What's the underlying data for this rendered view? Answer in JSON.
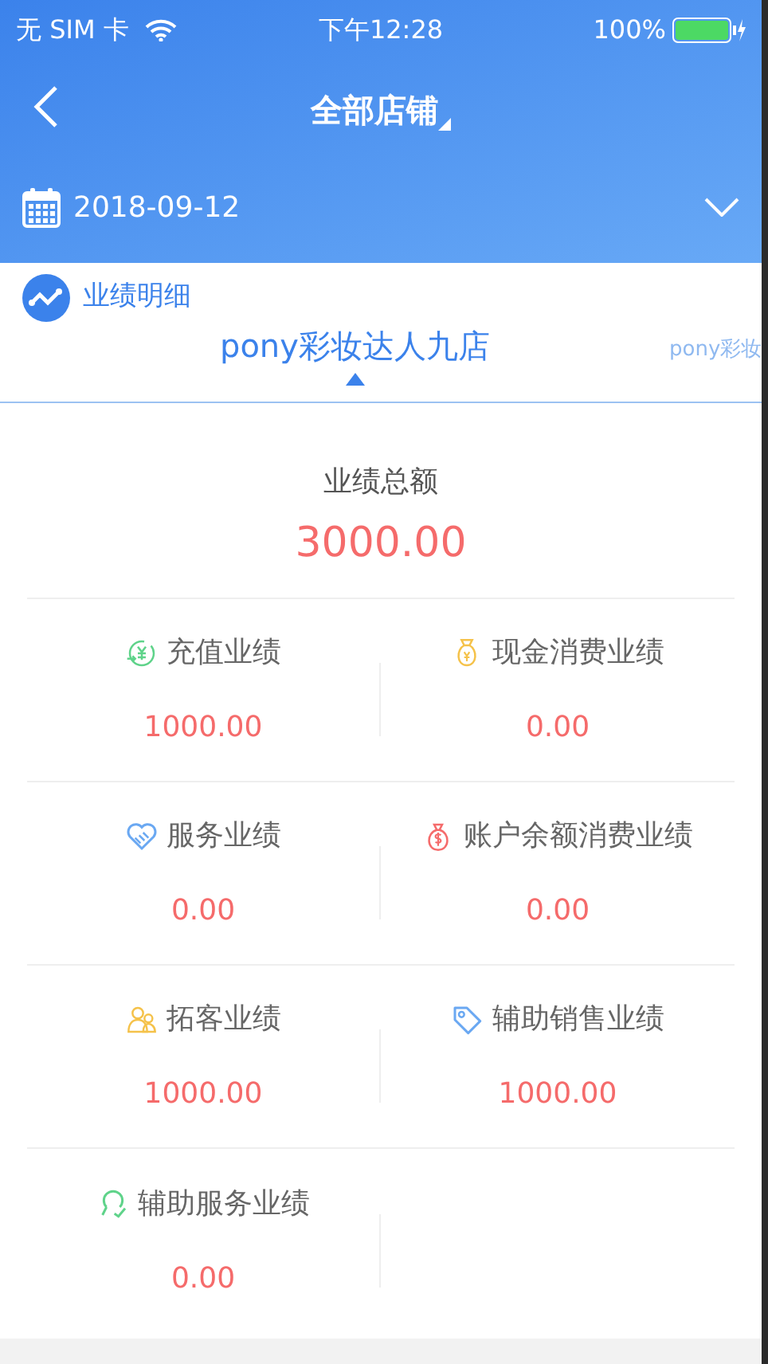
{
  "status_bar": {
    "carrier": "无 SIM 卡",
    "time": "下午12:28",
    "battery": "100%"
  },
  "nav": {
    "title": "全部店铺"
  },
  "date_picker": {
    "value": "2018-09-12"
  },
  "section": {
    "title": "业绩明细"
  },
  "store_tabs": [
    {
      "label": "pony彩妆达人九店",
      "selected": true
    },
    {
      "label": "pony彩妆",
      "selected": false
    }
  ],
  "total": {
    "label": "业绩总额",
    "value": "3000.00"
  },
  "metrics": [
    {
      "label": "充值业绩",
      "value": "1000.00",
      "color": "#5fd38a"
    },
    {
      "label": "现金消费业绩",
      "value": "0.00",
      "color": "#f5c24a"
    },
    {
      "label": "服务业绩",
      "value": "0.00",
      "color": "#6aa8f2"
    },
    {
      "label": "账户余额消费业绩",
      "value": "0.00",
      "color": "#f56b6b"
    },
    {
      "label": "拓客业绩",
      "value": "1000.00",
      "color": "#f5c24a"
    },
    {
      "label": "辅助销售业绩",
      "value": "1000.00",
      "color": "#6aa8f2"
    },
    {
      "label": "辅助服务业绩",
      "value": "0.00",
      "color": "#5fd38a"
    }
  ]
}
